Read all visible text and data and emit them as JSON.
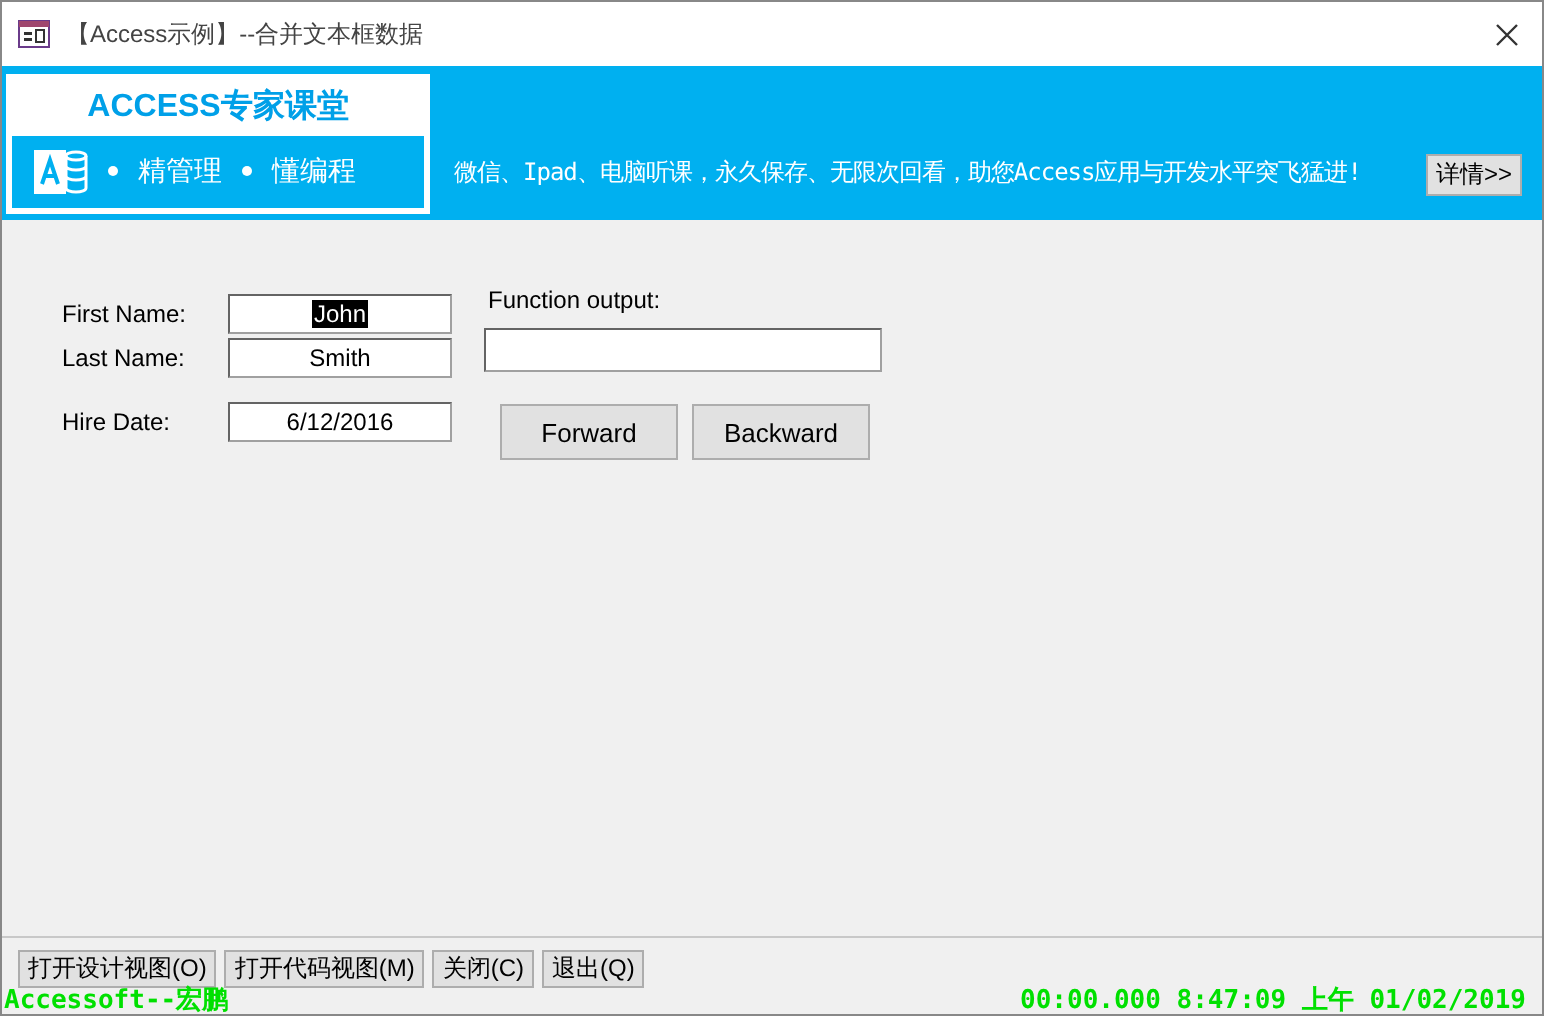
{
  "window": {
    "title": "【Access示例】--合并文本框数据"
  },
  "banner": {
    "brand": "ACCESS专家课堂",
    "tagline": [
      "精管理",
      "懂编程"
    ],
    "promo": "微信、Ipad、电脑听课，永久保存、无限次回看，助您Access应用与开发水平突飞猛进!",
    "details_button": "详情>>"
  },
  "form": {
    "fields": [
      {
        "label": "First Name:",
        "value": "John",
        "highlighted": true
      },
      {
        "label": "Last Name:",
        "value": "Smith",
        "highlighted": false
      },
      {
        "label": "Hire Date:",
        "value": "6/12/2016",
        "highlighted": false
      }
    ],
    "output": {
      "label": "Function output:"
    },
    "buttons": [
      "Forward",
      "Backward"
    ]
  },
  "bottom_buttons": [
    "打开设计视图(O)",
    "打开代码视图(M)",
    "关闭(C)",
    "退出(Q)"
  ],
  "status_bar": {
    "left": "Accessoft--宏鹏",
    "right": "00:00.000 8:47:09 上午 01/02/2019"
  }
}
